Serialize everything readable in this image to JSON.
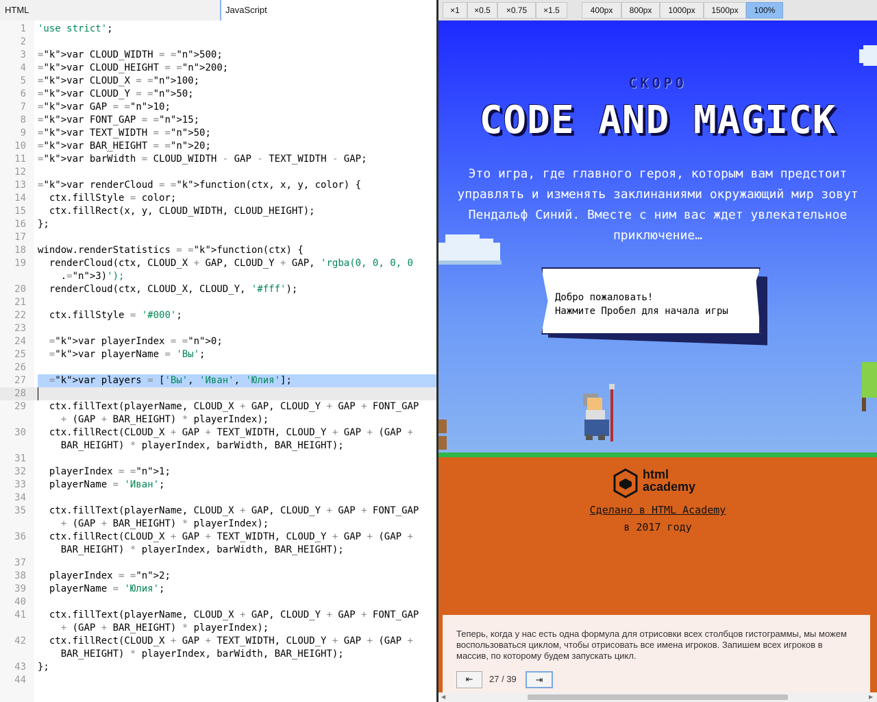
{
  "editor": {
    "tabs": [
      {
        "label": "HTML"
      },
      {
        "label": "JavaScript"
      }
    ],
    "lines": [
      {
        "n": "1",
        "t": "'use strict';"
      },
      {
        "n": "2",
        "t": ""
      },
      {
        "n": "3",
        "t": "var CLOUD_WIDTH = 500;"
      },
      {
        "n": "4",
        "t": "var CLOUD_HEIGHT = 200;"
      },
      {
        "n": "5",
        "t": "var CLOUD_X = 100;"
      },
      {
        "n": "6",
        "t": "var CLOUD_Y = 50;"
      },
      {
        "n": "7",
        "t": "var GAP = 10;"
      },
      {
        "n": "8",
        "t": "var FONT_GAP = 15;"
      },
      {
        "n": "9",
        "t": "var TEXT_WIDTH = 50;"
      },
      {
        "n": "10",
        "t": "var BAR_HEIGHT = 20;"
      },
      {
        "n": "11",
        "t": "var barWidth = CLOUD_WIDTH - GAP - TEXT_WIDTH - GAP;"
      },
      {
        "n": "12",
        "t": ""
      },
      {
        "n": "13",
        "t": "var renderCloud = function(ctx, x, y, color) {"
      },
      {
        "n": "14",
        "t": "  ctx.fillStyle = color;"
      },
      {
        "n": "15",
        "t": "  ctx.fillRect(x, y, CLOUD_WIDTH, CLOUD_HEIGHT);"
      },
      {
        "n": "16",
        "t": "};"
      },
      {
        "n": "17",
        "t": ""
      },
      {
        "n": "18",
        "t": "window.renderStatistics = function(ctx) {"
      },
      {
        "n": "19",
        "t": "  renderCloud(ctx, CLOUD_X + GAP, CLOUD_Y + GAP, 'rgba(0, 0, 0, 0"
      },
      {
        "n": "",
        "t": "    .3)');"
      },
      {
        "n": "20",
        "t": "  renderCloud(ctx, CLOUD_X, CLOUD_Y, '#fff');"
      },
      {
        "n": "21",
        "t": ""
      },
      {
        "n": "22",
        "t": "  ctx.fillStyle = '#000';"
      },
      {
        "n": "23",
        "t": ""
      },
      {
        "n": "24",
        "t": "  var playerIndex = 0;"
      },
      {
        "n": "25",
        "t": "  var playerName = 'Вы';"
      },
      {
        "n": "26",
        "t": ""
      },
      {
        "n": "27",
        "t": "  var players = ['Вы', 'Иван', 'Юлия'];"
      },
      {
        "n": "28",
        "t": ""
      },
      {
        "n": "29",
        "t": "  ctx.fillText(playerName, CLOUD_X + GAP, CLOUD_Y + GAP + FONT_GAP"
      },
      {
        "n": "",
        "t": "    + (GAP + BAR_HEIGHT) * playerIndex);"
      },
      {
        "n": "30",
        "t": "  ctx.fillRect(CLOUD_X + GAP + TEXT_WIDTH, CLOUD_Y + GAP + (GAP +"
      },
      {
        "n": "",
        "t": "    BAR_HEIGHT) * playerIndex, barWidth, BAR_HEIGHT);"
      },
      {
        "n": "31",
        "t": ""
      },
      {
        "n": "32",
        "t": "  playerIndex = 1;"
      },
      {
        "n": "33",
        "t": "  playerName = 'Иван';"
      },
      {
        "n": "34",
        "t": ""
      },
      {
        "n": "35",
        "t": "  ctx.fillText(playerName, CLOUD_X + GAP, CLOUD_Y + GAP + FONT_GAP"
      },
      {
        "n": "",
        "t": "    + (GAP + BAR_HEIGHT) * playerIndex);"
      },
      {
        "n": "36",
        "t": "  ctx.fillRect(CLOUD_X + GAP + TEXT_WIDTH, CLOUD_Y + GAP + (GAP +"
      },
      {
        "n": "",
        "t": "    BAR_HEIGHT) * playerIndex, barWidth, BAR_HEIGHT);"
      },
      {
        "n": "37",
        "t": ""
      },
      {
        "n": "38",
        "t": "  playerIndex = 2;"
      },
      {
        "n": "39",
        "t": "  playerName = 'Юлия';"
      },
      {
        "n": "40",
        "t": ""
      },
      {
        "n": "41",
        "t": "  ctx.fillText(playerName, CLOUD_X + GAP, CLOUD_Y + GAP + FONT_GAP"
      },
      {
        "n": "",
        "t": "    + (GAP + BAR_HEIGHT) * playerIndex);"
      },
      {
        "n": "42",
        "t": "  ctx.fillRect(CLOUD_X + GAP + TEXT_WIDTH, CLOUD_Y + GAP + (GAP +"
      },
      {
        "n": "",
        "t": "    BAR_HEIGHT) * playerIndex, barWidth, BAR_HEIGHT);"
      },
      {
        "n": "43",
        "t": "};"
      },
      {
        "n": "44",
        "t": ""
      }
    ],
    "selected_line": "27",
    "cursor_line": "28"
  },
  "preview_toolbar": {
    "scale_buttons": [
      "×1",
      "×0.5",
      "×0.75",
      "×1.5"
    ],
    "width_buttons": [
      "400px",
      "800px",
      "1000px",
      "1500px",
      "100%"
    ],
    "active": "100%"
  },
  "page": {
    "soon": "СКОРО",
    "title": "CODE AND MAGICK",
    "intro": "Это игра, где главного героя, которым вам предстоит управлять и изменять заклинаниями окружающий мир зовут Пендальф Синий. Вместе с ним вас ждет увлекательное приключение…",
    "dialog_line1": "Добро пожаловать!",
    "dialog_line2": "Нажмите Пробел для начала игры",
    "logo_line1": "html",
    "logo_line2": "academy",
    "made_link": "Сделано в HTML Academy",
    "year": "в 2017 году"
  },
  "lesson": {
    "text": "Теперь, когда у нас есть одна формула для отрисовки всех столбцов гистограммы, мы можем воспользоваться циклом, чтобы отрисовать все имена игроков. Запишем всех игроков в массив, по которому будем запускать цикл.",
    "prev_icon": "⇤",
    "next_icon": "⇥",
    "counter": "27 / 39"
  },
  "colors": {
    "sky_top": "#1e2aff",
    "grass": "#2fb64a",
    "ground": "#d8621c",
    "selection": "#b5d5ff"
  }
}
